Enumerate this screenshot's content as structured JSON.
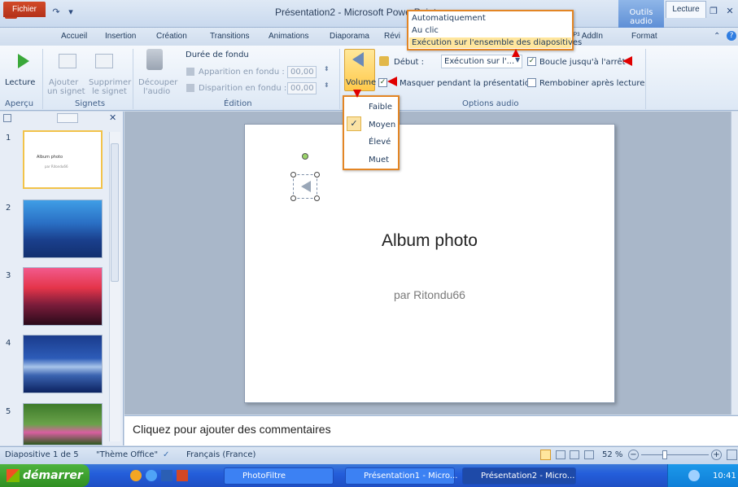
{
  "window": {
    "title": "Présentation2 - Microsoft PowerPoint",
    "app_icon_letter": "P",
    "context_group": "Outils audio",
    "qat": [
      "💾",
      "↶",
      "↷",
      "▾"
    ],
    "controls": [
      "▭",
      "❐",
      "✕"
    ]
  },
  "tabs": {
    "file": "Fichier",
    "items": [
      "Accueil",
      "Insertion",
      "Création",
      "Transitions",
      "Animations",
      "Diaporama",
      "Révi"
    ],
    "addin": "ᴾ³ AddIn",
    "format": "Format",
    "lecture": "Lecture"
  },
  "ribbon": {
    "preview": {
      "play_label": "Lecture",
      "group": "Aperçu"
    },
    "bookmarks": {
      "add_line1": "Ajouter",
      "add_line2": "un signet",
      "remove_line1": "Supprimer",
      "remove_line2": "le signet",
      "group": "Signets"
    },
    "editing": {
      "trim_line1": "Découper",
      "trim_line2": "l'audio",
      "fade_title": "Durée de fondu",
      "fade_in_label": "Apparition en fondu :",
      "fade_in_value": "00,00",
      "fade_out_label": "Disparition en fondu :",
      "fade_out_value": "00,00",
      "group": "Édition"
    },
    "audio_options": {
      "volume_label": "Volume",
      "start_label": "Début :",
      "start_value": "Exécution sur l'...",
      "hide_label": "Masquer pendant la présentation",
      "loop_label": "Boucle jusqu'à l'arrêt",
      "rewind_label": "Rembobiner après lecture",
      "group": "Options audio"
    }
  },
  "start_dropdown": {
    "options": [
      "Automatiquement",
      "Au clic",
      "Exécution sur l'ensemble des diapositives"
    ],
    "selected_index": 2
  },
  "volume_menu": {
    "options": [
      "Faible",
      "Moyen",
      "Élevé",
      "Muet"
    ],
    "checked": "Moyen"
  },
  "slides": {
    "numbers": [
      "1",
      "2",
      "3",
      "4",
      "5"
    ],
    "thumb1_title": "Album photo",
    "thumb1_subtitle": "par Ritondu66"
  },
  "slide": {
    "title": "Album photo",
    "subtitle": "par Ritondu66"
  },
  "notes": {
    "placeholder": "Cliquez pour ajouter des commentaires"
  },
  "status": {
    "slide_info": "Diapositive 1 de 5",
    "theme": "\"Thème Office\"",
    "language": "Français (France)",
    "zoom": "52 %"
  },
  "taskbar": {
    "start": "démarrer",
    "items": [
      "PhotoFiltre",
      "Présentation1 - Micro...",
      "Présentation2 - Micro..."
    ],
    "clock": "10:41"
  },
  "colors": {
    "highlight": "#ffe69d",
    "callout_border": "#e38524",
    "annotation_red": "#e00000",
    "file_tab": "#c43b1d"
  }
}
